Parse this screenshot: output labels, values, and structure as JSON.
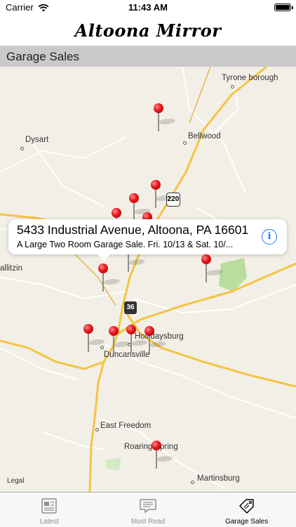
{
  "status_bar": {
    "carrier": "Carrier",
    "time": "11:43 AM"
  },
  "masthead": {
    "title": "Altoona Mirror"
  },
  "section": {
    "title": "Garage Sales"
  },
  "map": {
    "labels": {
      "tyrone": "Tyrone borough",
      "dysart": "Dysart",
      "bellwood": "Bellwood",
      "gallitzin": "allitzin",
      "hollidaysburg": "Hollidaysburg",
      "duncansville": "Duncansville",
      "east_freedom": "East Freedom",
      "roaring_spring": "Roaring Spring",
      "martinsburg": "Martinsburg"
    },
    "route_220": "220",
    "route_36": "36",
    "legal": "Legal",
    "pin_count": 14,
    "colors": {
      "land": "#f2efe6",
      "highway": "#f6c343",
      "pin": "#e8141a",
      "park": "#b9dd9a"
    }
  },
  "callout": {
    "title": "5433 Industrial Avenue, Altoona, PA 16601",
    "subtitle": "A Large Two Room Garage Sale.  Fri. 10/13 & Sat. 10/...",
    "info_icon": "i"
  },
  "tabs": [
    {
      "label": "Latest",
      "icon": "newspaper-icon",
      "active": false
    },
    {
      "label": "Most Read",
      "icon": "message-icon",
      "active": false
    },
    {
      "label": "Garage Sales",
      "icon": "tag-icon",
      "active": true
    }
  ],
  "accent_color": "#1a7af8"
}
